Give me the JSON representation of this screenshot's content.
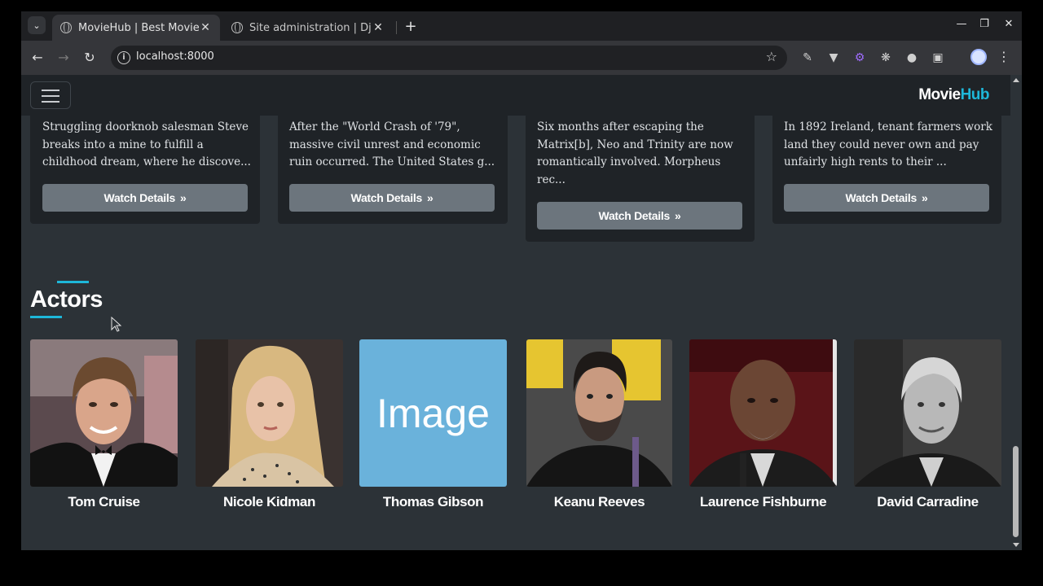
{
  "browser": {
    "tabs": [
      {
        "title": "MovieHub | Best Movie R",
        "active": true
      },
      {
        "title": "Site administration | Djar",
        "active": false
      }
    ],
    "url": "localhost:8000"
  },
  "navbar": {
    "brand_part1": "Movie",
    "brand_part2": "Hub"
  },
  "movie_cards": [
    {
      "description": "Struggling doorknob salesman Steve breaks into a mine to fulfill a childhood dream, where he discove...",
      "button": "Watch Details"
    },
    {
      "description": "After the \"World Crash of '79\", massive civil unrest and economic ruin occurred. The United States g...",
      "button": "Watch Details"
    },
    {
      "description": "Six months after escaping the Matrix[b], Neo and Trinity are now romantically involved. Morpheus rec...",
      "button": "Watch Details"
    },
    {
      "description": "In 1892 Ireland, tenant farmers work land they could never own and pay unfairly high rents to their ...",
      "button": "Watch Details"
    }
  ],
  "actors_section": {
    "title": "Actors",
    "actors": [
      {
        "name": "Tom Cruise"
      },
      {
        "name": "Nicole Kidman"
      },
      {
        "name": "Thomas Gibson",
        "placeholder_text": "Image"
      },
      {
        "name": "Keanu Reeves"
      },
      {
        "name": "Laurence Fishburne"
      },
      {
        "name": "David Carradine"
      }
    ]
  },
  "colors": {
    "page_bg": "#2c3237",
    "card_bg": "#1f2327",
    "accent": "#1eb7d9",
    "button_bg": "#6c757d"
  }
}
